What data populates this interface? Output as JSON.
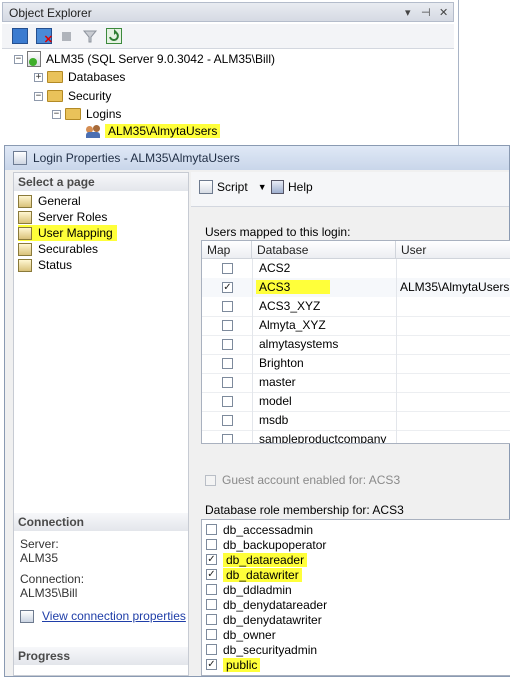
{
  "object_explorer": {
    "title": "Object Explorer",
    "controls": [
      "▾",
      "⊣",
      "✕"
    ],
    "tree": {
      "root": "ALM35 (SQL Server 9.0.3042 - ALM35\\Bill)",
      "databases": "Databases",
      "security": "Security",
      "logins": "Logins",
      "selected_login": "ALM35\\AlmytaUsers"
    }
  },
  "dialog": {
    "title": "Login Properties - ALM35\\AlmytaUsers",
    "select_page": {
      "header": "Select a page",
      "items": [
        "General",
        "Server Roles",
        "User Mapping",
        "Securables",
        "Status"
      ]
    },
    "connection": {
      "header": "Connection",
      "server_label": "Server:",
      "server_value": "ALM35",
      "connection_label": "Connection:",
      "connection_value": "ALM35\\Bill",
      "view_link": "View connection properties"
    },
    "progress": {
      "header": "Progress"
    },
    "toolbar": {
      "script": "Script",
      "help": "Help"
    },
    "users_mapped": {
      "label": "Users mapped to this login:",
      "columns": {
        "map": "Map",
        "database": "Database",
        "user": "User"
      },
      "rows": [
        {
          "database": "ACS2",
          "checked": false,
          "user": ""
        },
        {
          "database": "ACS3",
          "checked": true,
          "user": "ALM35\\AlmytaUsers"
        },
        {
          "database": "ACS3_XYZ",
          "checked": false,
          "user": ""
        },
        {
          "database": "Almyta_XYZ",
          "checked": false,
          "user": ""
        },
        {
          "database": "almytasystems",
          "checked": false,
          "user": ""
        },
        {
          "database": "Brighton",
          "checked": false,
          "user": ""
        },
        {
          "database": "master",
          "checked": false,
          "user": ""
        },
        {
          "database": "model",
          "checked": false,
          "user": ""
        },
        {
          "database": "msdb",
          "checked": false,
          "user": ""
        },
        {
          "database": "sampleproductcompany",
          "checked": false,
          "user": ""
        }
      ]
    },
    "guest_account": "Guest account enabled for: ACS3",
    "role_membership": {
      "label": "Database role membership for: ACS3",
      "roles": [
        {
          "name": "db_accessadmin",
          "checked": false
        },
        {
          "name": "db_backupoperator",
          "checked": false
        },
        {
          "name": "db_datareader",
          "checked": true
        },
        {
          "name": "db_datawriter",
          "checked": true
        },
        {
          "name": "db_ddladmin",
          "checked": false
        },
        {
          "name": "db_denydatareader",
          "checked": false
        },
        {
          "name": "db_denydatawriter",
          "checked": false
        },
        {
          "name": "db_owner",
          "checked": false
        },
        {
          "name": "db_securityadmin",
          "checked": false
        },
        {
          "name": "public",
          "checked": true
        }
      ]
    }
  }
}
